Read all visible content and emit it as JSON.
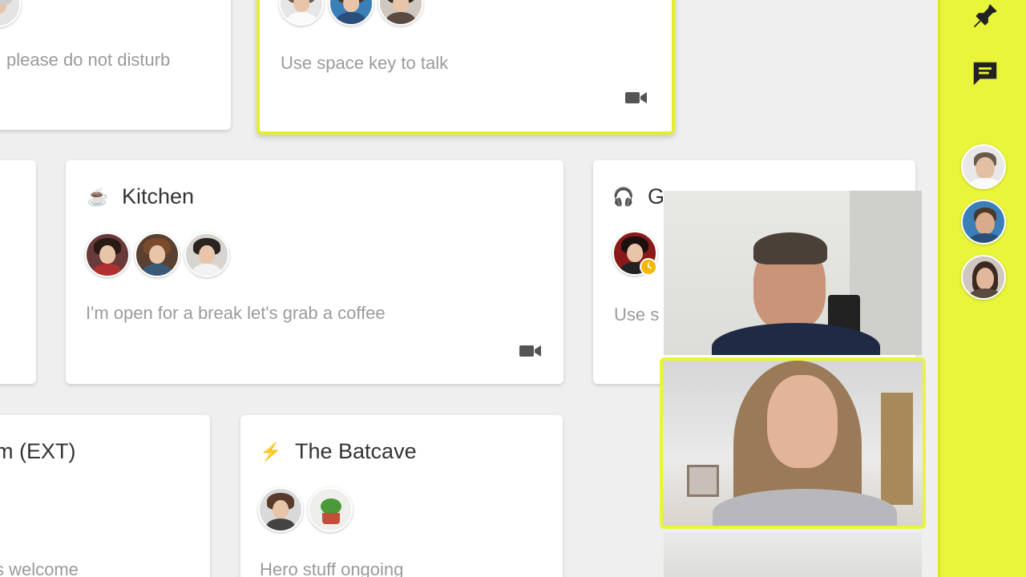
{
  "rooms": [
    {
      "name": "",
      "emoji": "",
      "status": "please do not disturb",
      "truncated_left": true
    },
    {
      "name": "",
      "emoji": "",
      "status": "Use space key to talk",
      "active": true
    },
    {
      "name": "Kitchen",
      "emoji": "☕",
      "status": "I'm open for a break let's grab a coffee"
    },
    {
      "name": "G",
      "emoji": "🎧",
      "status": "Use s"
    },
    {
      "name": "m (EXT)",
      "emoji": "",
      "status": "s welcome"
    },
    {
      "name": "The Batcave",
      "emoji": "⚡",
      "status": "Hero stuff ongoing"
    }
  ],
  "icons": {
    "camera": "video-camera-icon",
    "pin": "pin-icon",
    "chat": "chat-icon",
    "away": "clock-away-icon"
  },
  "colors": {
    "accent": "#e8f53a",
    "background": "#efefef",
    "card": "#ffffff",
    "status_text": "#9a9a9a"
  }
}
